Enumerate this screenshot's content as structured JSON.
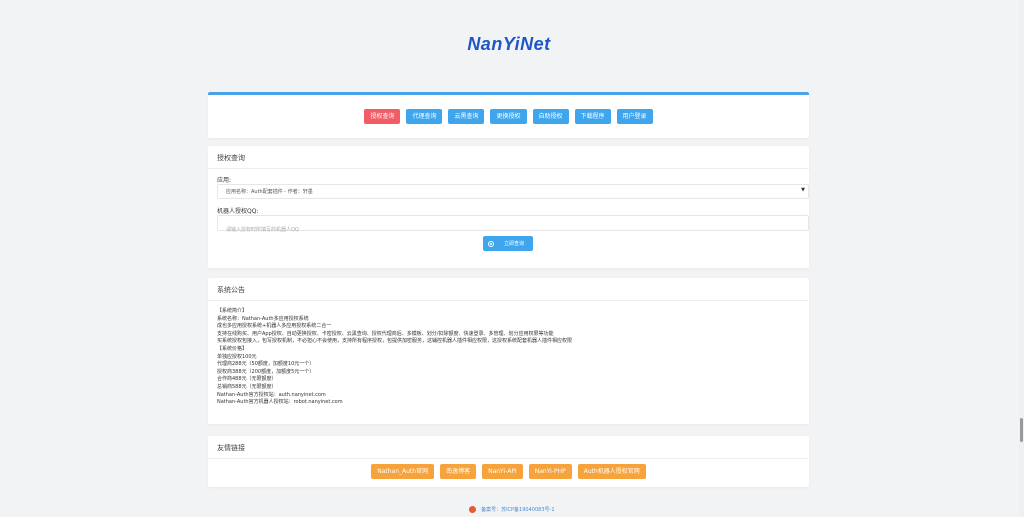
{
  "header": {
    "logo_text": "NanYiNet"
  },
  "nav": {
    "buttons": [
      {
        "label": "授权查询",
        "color": "#f25c66"
      },
      {
        "label": "代理查询",
        "color": "#3fa6ee"
      },
      {
        "label": "云黑查询",
        "color": "#3fa6ee"
      },
      {
        "label": "更换授权",
        "color": "#3fa6ee"
      },
      {
        "label": "自助授权",
        "color": "#3fa6ee"
      },
      {
        "label": "下载程序",
        "color": "#3fa6ee"
      },
      {
        "label": "用户登录",
        "color": "#3fa6ee"
      }
    ]
  },
  "query": {
    "title": "授权查询",
    "app_label": "应用:",
    "app_selected": "应用名称：Auth配套插件 - 作者：轩墨",
    "qq_label": "机器人授权QQ:",
    "qq_placeholder": "请输入授权时所填写的机器人QQ",
    "submit_label": "立即查询"
  },
  "notice": {
    "title": "系统公告",
    "lines": [
      "【系统简介】",
      "系统名称：Nathan-Auth多应用授权系统",
      "成也多应用授权系统+机器人多应用授权系统二合一",
      "支持在线购买、用户App授权、自动更换授权、卡密授权、云黑查询、授权代理商后、多模板、划分/扣除额度、快速登录、多管理、划分应用权限等功能",
      "买系统授权包接入，包写授权机制，不必担心不会使用，支持所有程序授权，包提供加密服务，这辅控机器人插件相应权限，这授权系统配套机器人插件相应权限",
      "【系统价格】",
      "单独应授权100元",
      "代理商288元（50额度，加额度10元一个）",
      "授权商388元（200额度，加额度5元一个）",
      "合作商488元（无限额度）",
      "总销商588元（无限额度）",
      "Nathan-Auth官方授权站：auth.nanyinet.com",
      "Nathan-Auth官方机器人授权站：robot.nanyinet.com"
    ]
  },
  "links": {
    "title": "友情链接",
    "items": [
      {
        "label": "Nathan_Auth官网"
      },
      {
        "label": "南逸博客"
      },
      {
        "label": "NanYi-API"
      },
      {
        "label": "NanYi-PHP"
      },
      {
        "label": "Auth机器人授权官网"
      }
    ],
    "color": "#f6a33c"
  },
  "footer": {
    "text": "备案号：苏ICP备19040083号-1"
  }
}
